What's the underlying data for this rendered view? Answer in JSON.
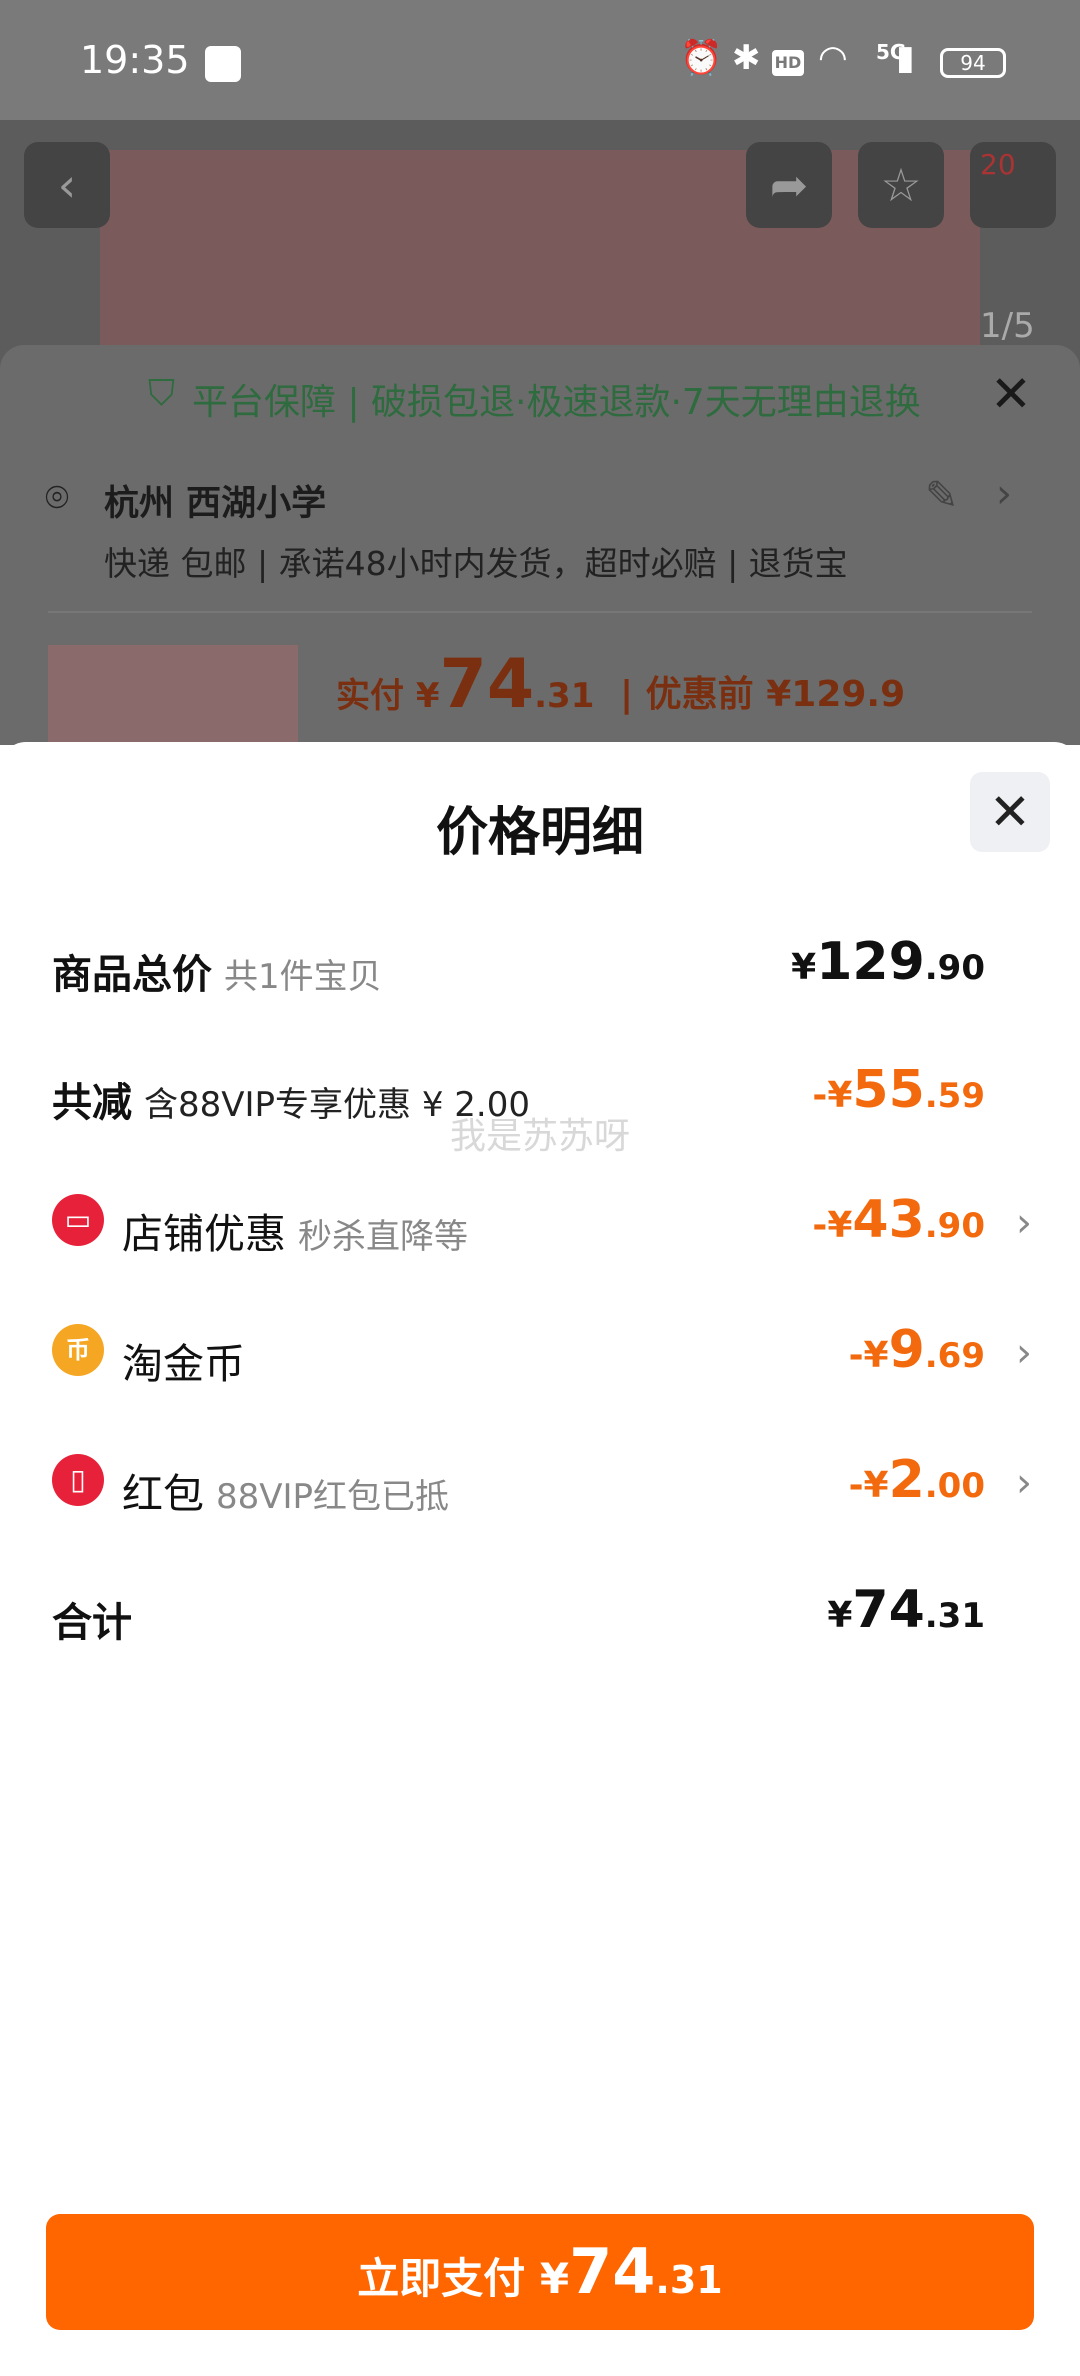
{
  "status_bar": {
    "time": "19:35",
    "icons": [
      "alarm-icon",
      "bluetooth-icon",
      "hd-icon",
      "wifi-icon",
      "signal-5g-icon"
    ],
    "hd_label": "HD",
    "network_label": "5G",
    "battery": "94"
  },
  "background_page": {
    "cart_count": "20",
    "image_counter": "1/5",
    "guarantee_text": "平台保障 | 破损包退·极速退款·7天无理由退换",
    "address": "杭州 西湖小学",
    "shipping": "快递 包邮 | 承诺48小时内发货，超时必赔 | 退货宝",
    "paid_label": "实付 ¥",
    "paid_int": "74",
    "paid_dec": ".31",
    "before_label": "| 优惠前 ¥129.9"
  },
  "dialog": {
    "title": "价格明细",
    "watermark": "我是苏苏呀",
    "total_goods": {
      "label": "商品总价",
      "sub": "共1件宝贝",
      "currency": "¥",
      "int": "129",
      "dec": ".90"
    },
    "total_reduce": {
      "label": "共减",
      "sub": "含88VIP专享优惠 ¥ 2.00",
      "prefix": "-¥",
      "int": "55",
      "dec": ".59"
    },
    "store_discount": {
      "label": "店铺优惠",
      "sub": "秒杀直降等",
      "prefix": "-¥",
      "int": "43",
      "dec": ".90",
      "icon": "store-icon"
    },
    "taojinbi": {
      "label": "淘金币",
      "prefix": "-¥",
      "int": "9",
      "dec": ".69",
      "icon": "coin-icon",
      "icon_glyph": "币"
    },
    "red_packet": {
      "label": "红包",
      "sub": "88VIP红包已抵",
      "prefix": "-¥",
      "int": "2",
      "dec": ".00",
      "icon": "red-packet-icon"
    },
    "sum": {
      "label": "合计",
      "currency": "¥",
      "int": "74",
      "dec": ".31"
    }
  },
  "pay_button": {
    "label": "立即支付",
    "currency": "¥",
    "int": "74",
    "dec": ".31"
  },
  "colors": {
    "accent_orange": "#ff6600",
    "discount_orange": "#f36a0e",
    "green": "#2e6b3e"
  }
}
